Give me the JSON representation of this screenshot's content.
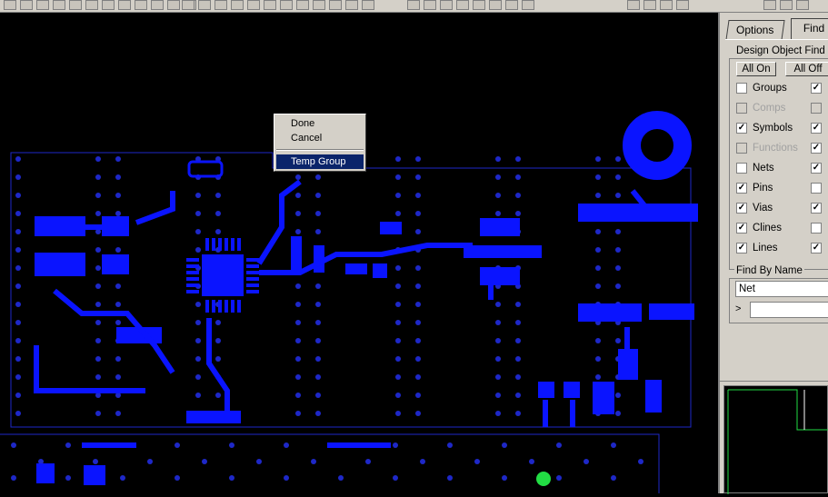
{
  "panel": {
    "tabs": [
      {
        "label": "Options"
      },
      {
        "label": "Find"
      }
    ],
    "filter_title": "Design Object Find Fi",
    "all_on": "All On",
    "all_off": "All Off",
    "items": [
      {
        "label": "Groups",
        "checked": false,
        "enabled": true,
        "col2_checked": true,
        "col2_enabled": true
      },
      {
        "label": "Comps",
        "checked": false,
        "enabled": false,
        "col2_checked": false,
        "col2_enabled": false
      },
      {
        "label": "Symbols",
        "checked": true,
        "enabled": true,
        "col2_checked": true,
        "col2_enabled": true
      },
      {
        "label": "Functions",
        "checked": false,
        "enabled": false,
        "col2_checked": true,
        "col2_enabled": true
      },
      {
        "label": "Nets",
        "checked": false,
        "enabled": true,
        "col2_checked": true,
        "col2_enabled": true
      },
      {
        "label": "Pins",
        "checked": true,
        "enabled": true,
        "col2_checked": false,
        "col2_enabled": true
      },
      {
        "label": "Vias",
        "checked": true,
        "enabled": true,
        "col2_checked": true,
        "col2_enabled": true
      },
      {
        "label": "Clines",
        "checked": true,
        "enabled": true,
        "col2_checked": false,
        "col2_enabled": true
      },
      {
        "label": "Lines",
        "checked": true,
        "enabled": true,
        "col2_checked": true,
        "col2_enabled": true
      }
    ],
    "find_by_name": {
      "title": "Find By Name",
      "type_value": "Net",
      "name_prefix": ">",
      "name_value": ""
    }
  },
  "context_menu": {
    "items": [
      "Done",
      "Cancel",
      "Temp Group"
    ],
    "selected": "Temp Group"
  },
  "colors": {
    "etch": "#0a14ff",
    "via": "#1e28c8",
    "highlight": "#22dd44",
    "background": "#000000"
  }
}
